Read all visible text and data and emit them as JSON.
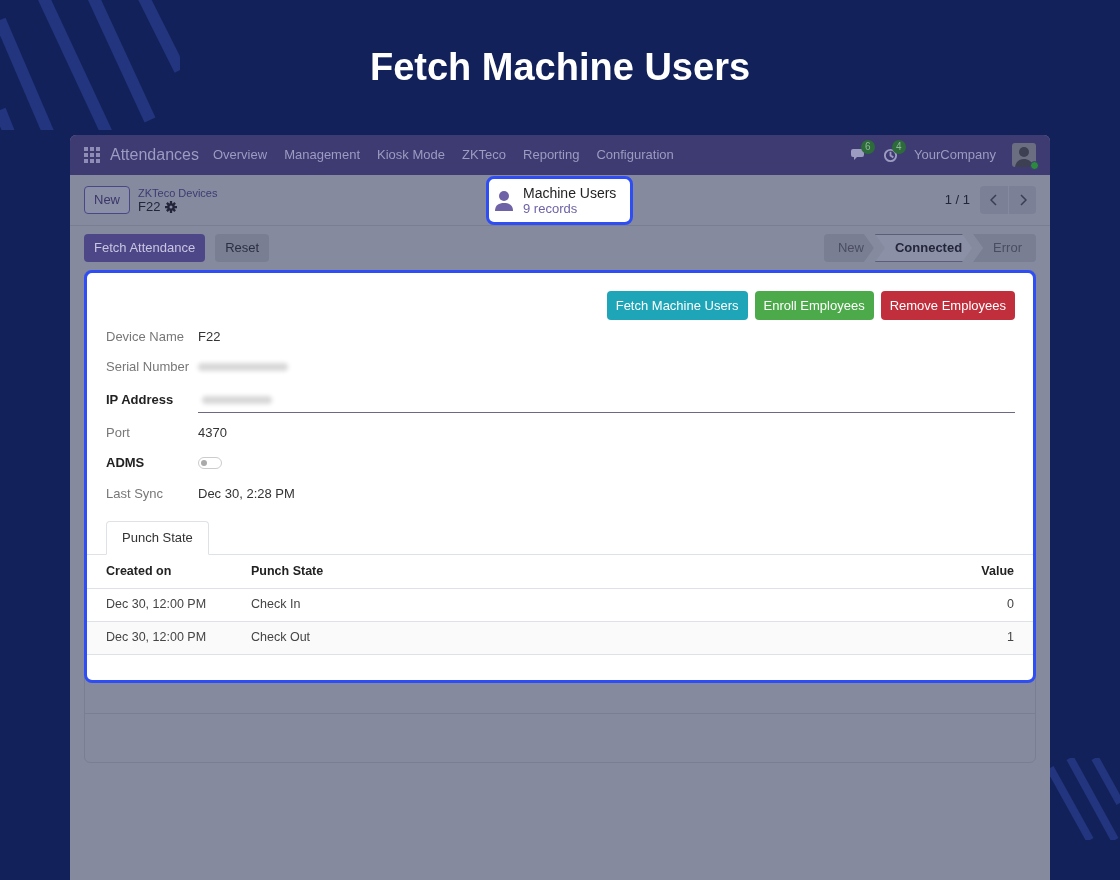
{
  "title": "Fetch Machine Users",
  "navbar": {
    "app": "Attendances",
    "menu": [
      "Overview",
      "Management",
      "Kiosk Mode",
      "ZKTeco",
      "Reporting",
      "Configuration"
    ],
    "chat_count": "6",
    "activity_count": "4",
    "company": "YourCompany"
  },
  "control_panel": {
    "new_button": "New",
    "breadcrumb_parent": "ZKTeco Devices",
    "record_name": "F22",
    "smart_button": {
      "label": "Machine Users",
      "count": "9 records"
    },
    "pager": "1 / 1"
  },
  "header_buttons": [
    {
      "label": "Fetch Attendance",
      "kind": "primary"
    },
    {
      "label": "Reset",
      "kind": "secondary"
    }
  ],
  "statusbar": [
    {
      "label": "New",
      "selected": false
    },
    {
      "label": "Connected",
      "selected": true
    },
    {
      "label": "Error",
      "selected": false
    }
  ],
  "form": {
    "action_buttons": [
      {
        "label": "Fetch Machine Users",
        "kind": "info"
      },
      {
        "label": "Enroll Employees",
        "kind": "success"
      },
      {
        "label": "Remove Employees",
        "kind": "danger"
      }
    ],
    "fields": [
      {
        "label": "Device Name",
        "kind": "text",
        "required": false,
        "value": "F22"
      },
      {
        "label": "Serial Number",
        "kind": "redacted",
        "required": false
      },
      {
        "label": "IP Address",
        "kind": "redacted_input",
        "required": true
      },
      {
        "label": "Port",
        "kind": "text",
        "required": false,
        "value": "4370"
      },
      {
        "label": "ADMS",
        "kind": "toggle",
        "required": true,
        "on": false
      },
      {
        "label": "Last Sync",
        "kind": "text",
        "required": false,
        "value": "Dec 30, 2:28 PM"
      }
    ],
    "tabs": [
      {
        "label": "Punch State",
        "selected": true
      }
    ],
    "table": {
      "columns": [
        "Created on",
        "Punch State",
        "Value"
      ],
      "rows": [
        [
          "Dec 30, 12:00 PM",
          "Check In",
          "0"
        ],
        [
          "Dec 30, 12:00 PM",
          "Check Out",
          "1"
        ]
      ]
    }
  }
}
